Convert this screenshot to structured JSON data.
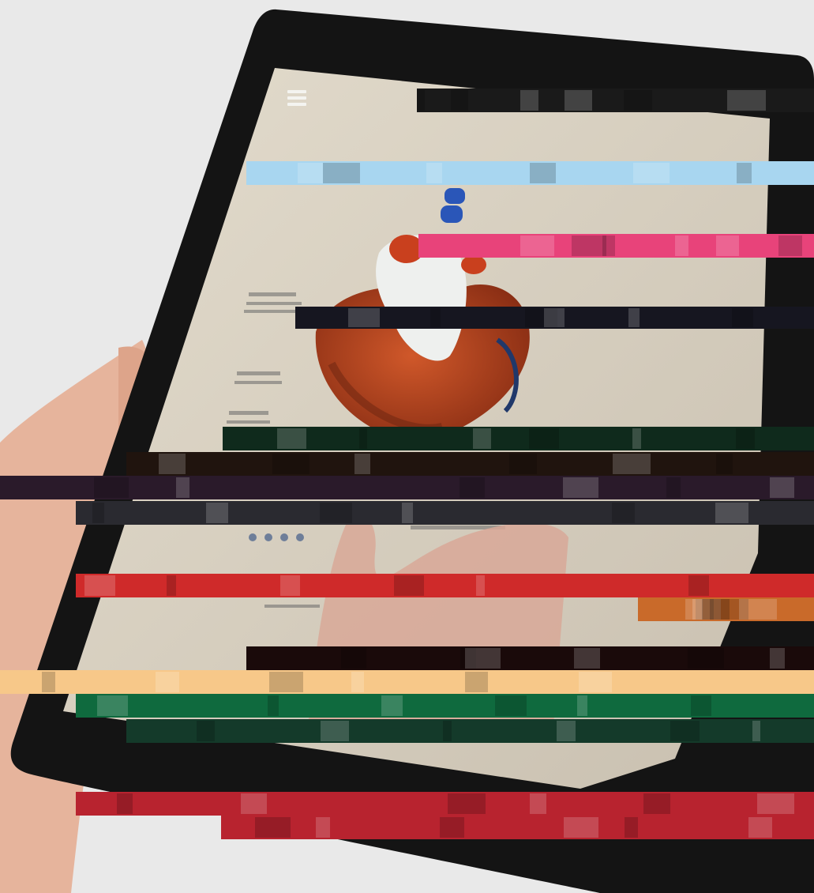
{
  "scene": {
    "description_visible": "",
    "colors": {
      "background": "#e9e9e9",
      "tablet_frame": "#141414",
      "screen_paper": "#d8d0c2",
      "heart_red": "#b8401c",
      "heart_dark": "#7e2a14",
      "aorta_white": "#eef0ee",
      "vessel_blue": "#2a56b8",
      "skin": "#e8b8a0",
      "glitch_pink": "#e8437a",
      "glitch_red": "#b8232f",
      "glitch_green": "#0f6a3e",
      "glitch_cyan": "#2fb6c8",
      "glitch_yellow": "#f3e34b",
      "glitch_peach": "#f7c889",
      "glitch_lightblue": "#a8d6f0",
      "glitch_dark": "#101010"
    },
    "icons": [
      "hamburger-menu-icon"
    ]
  },
  "glitch_bands": [
    {
      "color": "#1a1a1a"
    },
    {
      "color": "#a8d6f0"
    },
    {
      "color": "#e8437a"
    },
    {
      "color": "#161620"
    },
    {
      "color": "#0f2a1c"
    },
    {
      "color": "#20140e"
    },
    {
      "color": "#2a1a2a"
    },
    {
      "color": "#2a2a30"
    },
    {
      "color": "#cf2a2a"
    },
    {
      "color": "#c96a2a"
    },
    {
      "color": "#1a0a0a"
    },
    {
      "color": "#f7c889"
    },
    {
      "color": "#0f6a3e"
    },
    {
      "color": "#143a2a"
    },
    {
      "color": "#b8232f"
    },
    {
      "color": "#b8232f"
    }
  ]
}
